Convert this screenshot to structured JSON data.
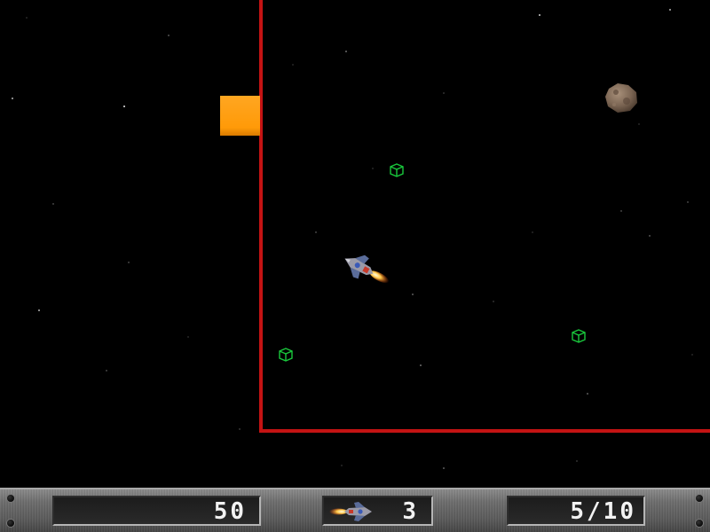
{
  "game": {
    "hud": {
      "score": "50",
      "lives": "3",
      "progress": "5/10"
    },
    "icons": {
      "lives_icon": "ship-icon",
      "pickup": "green-cube-icon",
      "hazard": "asteroid-icon",
      "block": "orange-block"
    },
    "colors": {
      "background": "#000000",
      "boundary": "#c41313",
      "block": "#ff9a08",
      "pickup": "#19c83c",
      "hud_text": "#f2f2f2"
    }
  }
}
